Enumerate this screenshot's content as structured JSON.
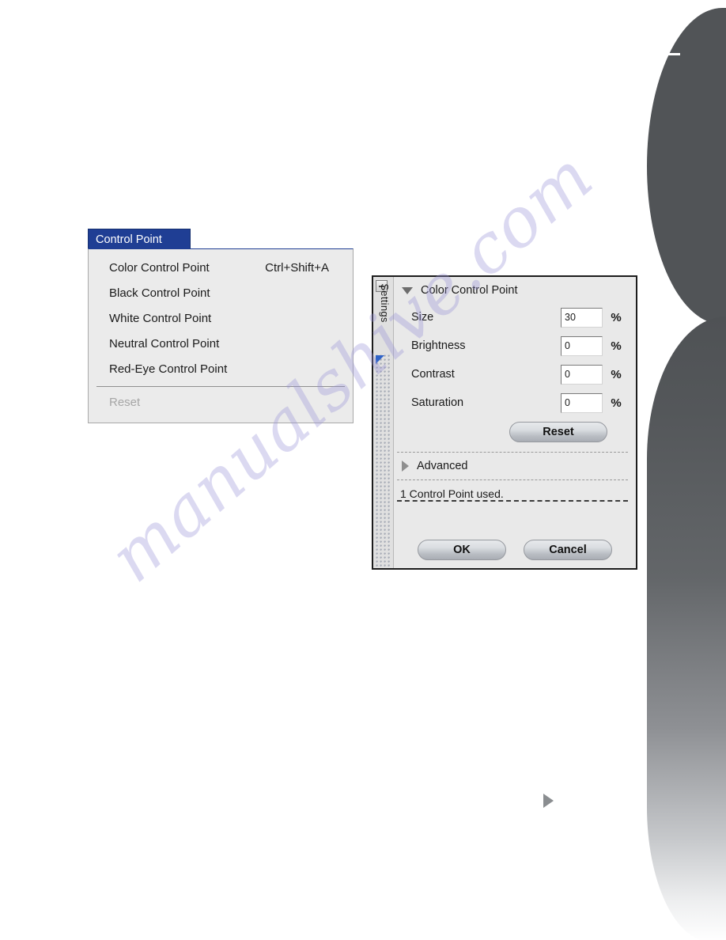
{
  "menu": {
    "title": "Control Point",
    "items": [
      {
        "label": "Color Control Point",
        "shortcut": "Ctrl+Shift+A",
        "disabled": false
      },
      {
        "label": "Black Control Point",
        "shortcut": "",
        "disabled": false
      },
      {
        "label": "White Control Point",
        "shortcut": "",
        "disabled": false
      },
      {
        "label": "Neutral Control Point",
        "shortcut": "",
        "disabled": false
      },
      {
        "label": "Red-Eye Control Point",
        "shortcut": "",
        "disabled": false
      }
    ],
    "reset_label": "Reset"
  },
  "dialog": {
    "rail_label": "Settings",
    "title": "Color Control Point",
    "fields": [
      {
        "label": "Size",
        "value": "30",
        "unit": "%"
      },
      {
        "label": "Brightness",
        "value": "0",
        "unit": "%"
      },
      {
        "label": "Contrast",
        "value": "0",
        "unit": "%"
      },
      {
        "label": "Saturation",
        "value": "0",
        "unit": "%"
      }
    ],
    "reset_label": "Reset",
    "advanced_label": "Advanced",
    "status": "1 Control Point used.",
    "ok_label": "OK",
    "cancel_label": "Cancel"
  },
  "watermark": {
    "text": "manualshive.com"
  },
  "colors": {
    "menu_titlebar": "#1f3e94",
    "menu_body": "#ebebeb",
    "dialog_body": "#e9e9e9",
    "edge_bar": "#515457",
    "rail_marker": "#2f63c8",
    "watermark": "#9691d7"
  }
}
